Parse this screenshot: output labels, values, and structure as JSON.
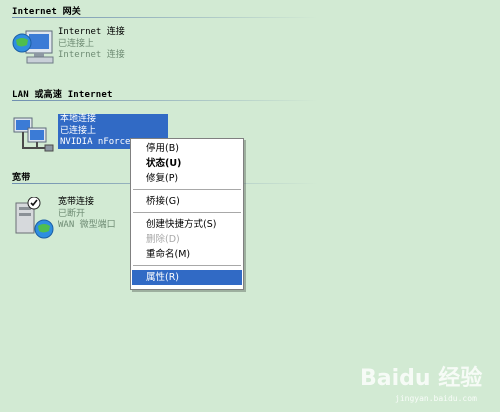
{
  "sections": {
    "internet_gateway": {
      "header": "Internet 网关",
      "connection": {
        "name": "Internet 连接",
        "status": "已连接上",
        "device": "Internet 连接",
        "icon": "internet-gateway-icon"
      }
    },
    "lan": {
      "header": "LAN 或高速 Internet",
      "connection": {
        "name": "本地连接",
        "status": "已连接上",
        "device": "NVIDIA nForce",
        "icon": "network-computers-icon"
      }
    },
    "broadband": {
      "header": "宽带",
      "connection": {
        "name": "宽带连接",
        "status": "已断开",
        "device": "WAN 微型端口",
        "icon": "broadband-connection-icon"
      }
    }
  },
  "context_menu": {
    "items": [
      {
        "label": "停用(B)",
        "style": "normal"
      },
      {
        "label": "状态(U)",
        "style": "bold"
      },
      {
        "label": "修复(P)",
        "style": "normal"
      },
      {
        "label": "桥接(G)",
        "style": "normal"
      },
      {
        "label": "创建快捷方式(S)",
        "style": "normal"
      },
      {
        "label": "删除(D)",
        "style": "disabled"
      },
      {
        "label": "重命名(M)",
        "style": "normal"
      },
      {
        "label": "属性(R)",
        "style": "active"
      }
    ]
  },
  "watermark": {
    "logo": "Baidu 经验",
    "url": "jingyan.baidu.com"
  },
  "colors": {
    "background": "#d2ead3",
    "selection": "#316ac5",
    "secondary_text": "#6f8c74"
  }
}
